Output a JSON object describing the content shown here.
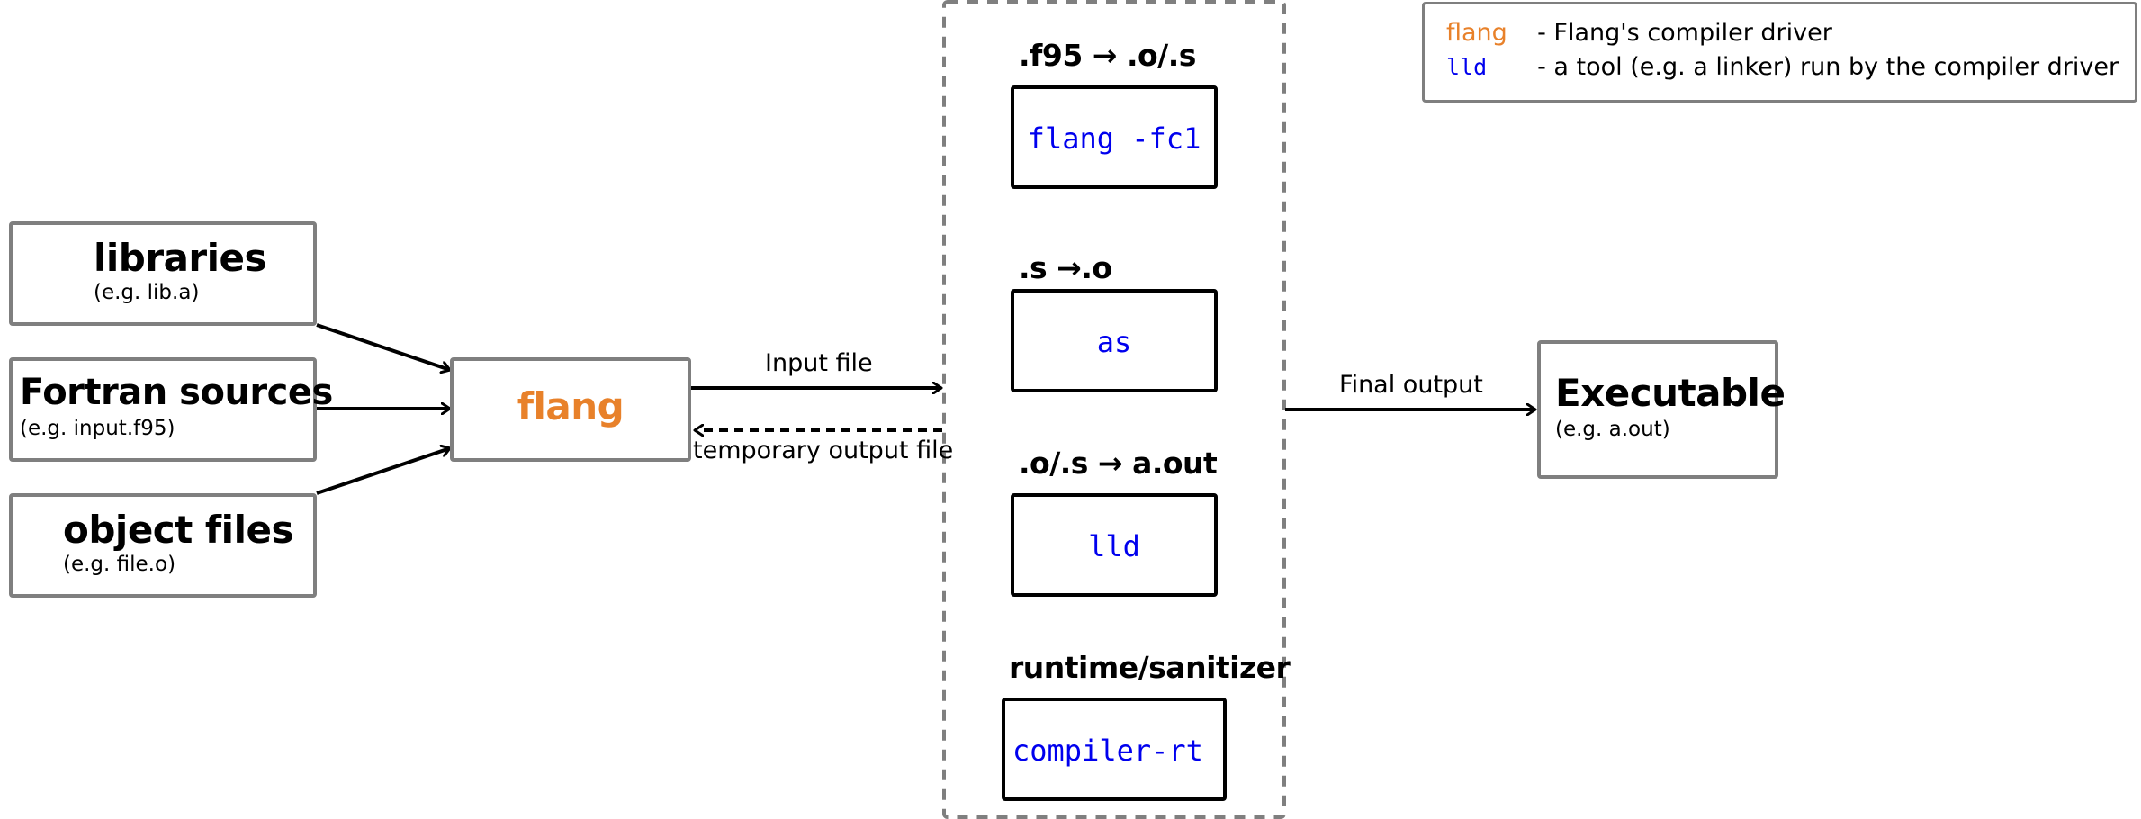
{
  "colors": {
    "driver": "#e8812a",
    "tool": "#0000ee",
    "box_border": "#7f7f7f",
    "dashed_border": "#7f7f7f"
  },
  "inputs": [
    {
      "title": "libraries",
      "subtitle": "(e.g. lib.a)"
    },
    {
      "title": "Fortran sources",
      "subtitle": "(e.g. input.f95)"
    },
    {
      "title": "object files",
      "subtitle": "(e.g. file.o)"
    }
  ],
  "driver": {
    "label": "flang"
  },
  "edges": {
    "input_file": "Input file",
    "temporary_output_file": "temporary output file",
    "final_output": "Final output"
  },
  "stages": [
    {
      "caption": ".f95 → .o/.s",
      "tool": "flang -fc1"
    },
    {
      "caption": ".s →.o",
      "tool": "as"
    },
    {
      "caption": ".o/.s → a.out",
      "tool": "lld"
    },
    {
      "caption": "runtime/sanitizer",
      "tool": "compiler-rt"
    }
  ],
  "output": {
    "title": "Executable",
    "subtitle": "(e.g. a.out)"
  },
  "legend": [
    {
      "key": "flang",
      "description": "- Flang's compiler driver",
      "kind": "driver"
    },
    {
      "key": "lld",
      "description": "- a tool (e.g. a linker) run by the compiler driver",
      "kind": "tool"
    }
  ]
}
